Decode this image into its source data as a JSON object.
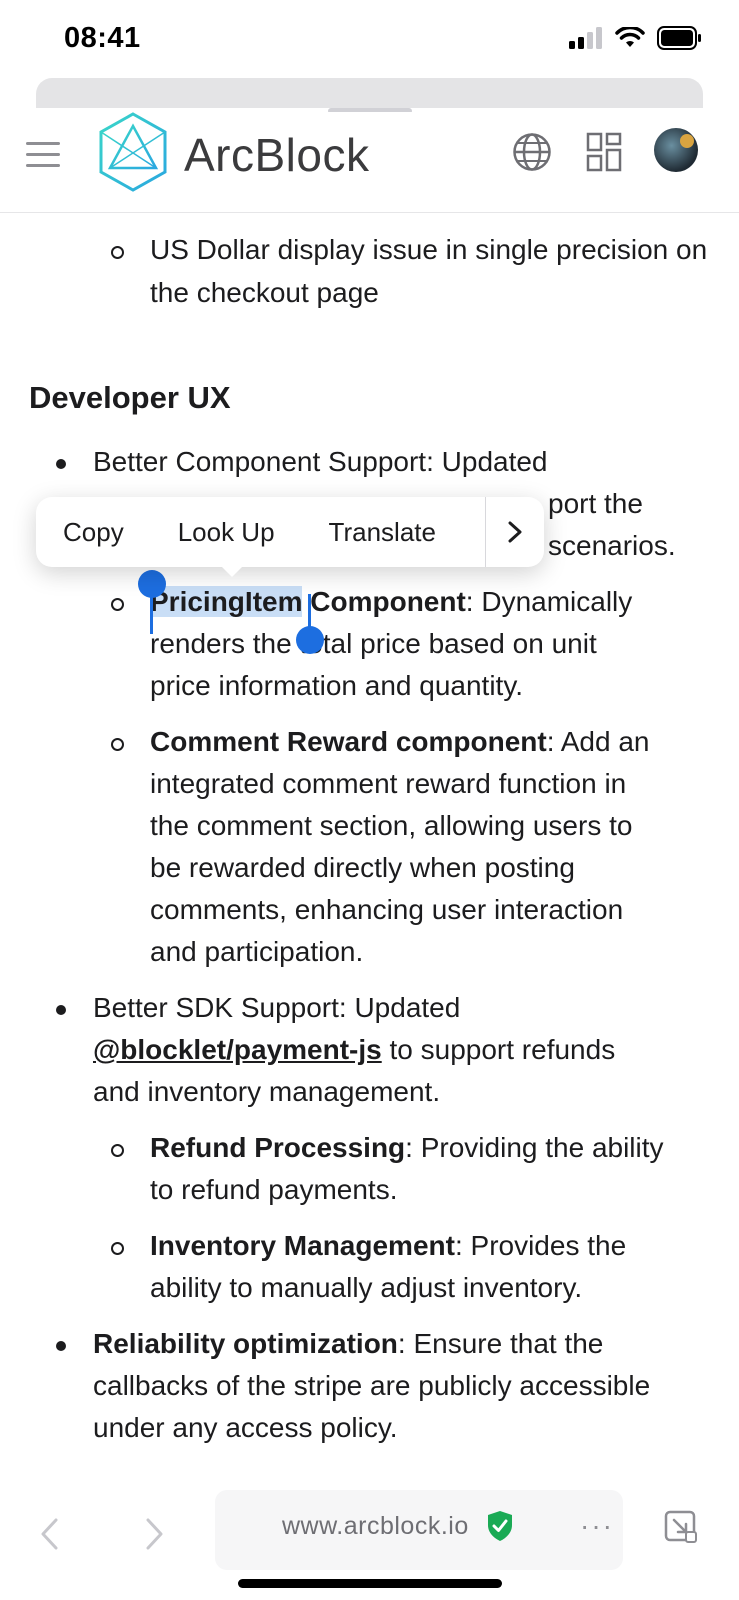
{
  "status_bar": {
    "time": "08:41"
  },
  "header": {
    "brand": "ArcBlock"
  },
  "content": {
    "prev_item": "US Dollar display issue in single precision on the checkout page",
    "section_heading": "Developer UX",
    "item1_line1": "Better Component Support: Updated",
    "item1_line2_tail": "port the",
    "item1_line3_tail": "scenarios.",
    "sub1_title_selected": "PricingItem",
    "sub1_title_rest": " Component",
    "sub1_desc_l1": ": Dynamically",
    "sub1_desc_l2": "renders the total price based on unit",
    "sub1_desc_l3": "price information and quantity.",
    "sub2_title": "Comment Reward component",
    "sub2_desc_l1": ": Add an",
    "sub2_desc_l2": "integrated comment reward function in",
    "sub2_desc_l3": "the comment section, allowing users to",
    "sub2_desc_l4": "be rewarded directly when posting",
    "sub2_desc_l5": "comments, enhancing user interaction",
    "sub2_desc_l6": "and participation.",
    "item2_line1": "Better SDK Support: Updated",
    "item2_link": "@blocklet/payment-js",
    "item2_line2_rest": " to support refunds",
    "item2_line3": "and inventory management.",
    "sub3_title": "Refund Processing",
    "sub3_desc_l1": ": Providing the ability",
    "sub3_desc_l2": "to refund payments.",
    "sub4_title": "Inventory Management",
    "sub4_desc_l1": ": Provides the",
    "sub4_desc_l2": "ability to manually adjust inventory.",
    "item3_title": "Reliability optimization",
    "item3_desc_l1": ": Ensure that the",
    "item3_desc_l2": "callbacks of the stripe are publicly accessible",
    "item3_desc_l3": "under any access policy."
  },
  "context_menu": {
    "items": [
      "Copy",
      "Look Up",
      "Translate"
    ],
    "more_icon": "chevron-right-icon"
  },
  "bottom_bar": {
    "url": "www.arcblock.io",
    "secure_color": "#1aaa55"
  },
  "colors": {
    "selection_handle": "#1d6ee0",
    "selection_bg": "#c9def6"
  }
}
